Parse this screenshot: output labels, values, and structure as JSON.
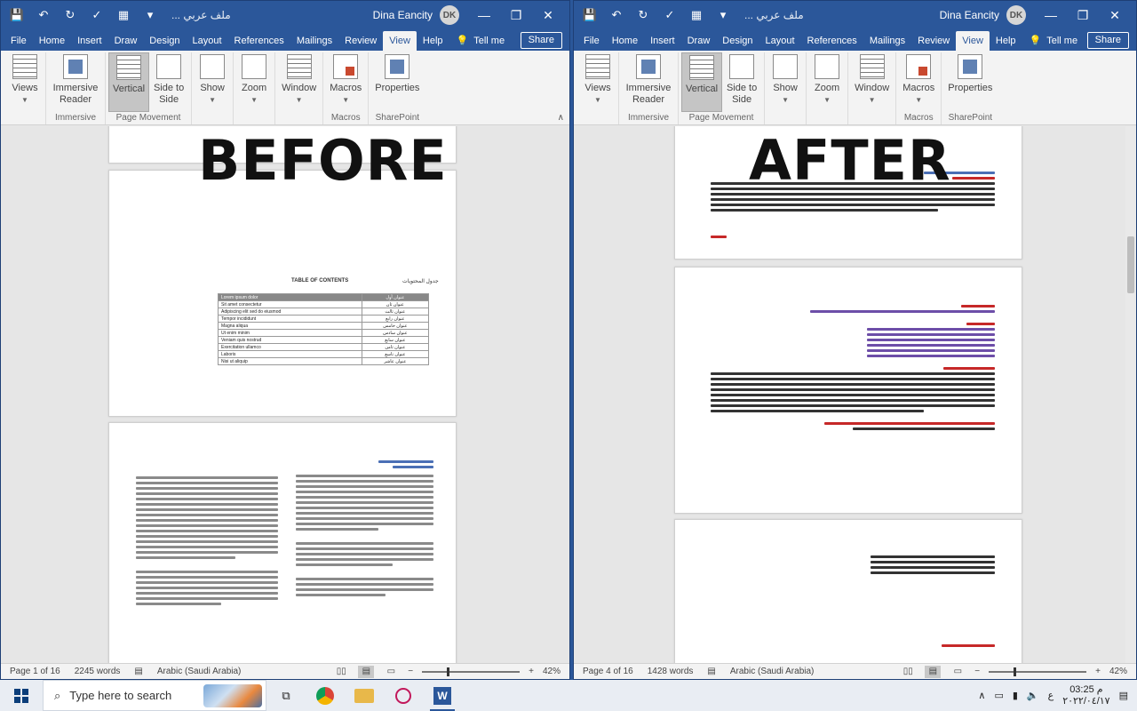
{
  "window": {
    "user_name": "Dina Eancity",
    "user_initials": "DK",
    "doc_title_left": "... ملف عربي",
    "doc_title_right": "... ملف عربي",
    "controls": {
      "minimize": "—",
      "restore": "❐",
      "close": "✕"
    }
  },
  "tabs_left": [
    "File",
    "Home",
    "Insert",
    "Draw",
    "Design",
    "Layout",
    "References",
    "Mailings",
    "Review",
    "View",
    "Help"
  ],
  "tabs_right": [
    "File",
    "Home",
    "Insert",
    "Draw",
    "Design",
    "Layout",
    "References",
    "Mailings",
    "Review",
    "View",
    "Help"
  ],
  "active_tab": "View",
  "tell_me": "Tell me",
  "share": "Share",
  "ribbon": {
    "views": "Views",
    "immersive_reader": "Immersive Reader",
    "immersive_group": "Immersive",
    "vertical": "Vertical",
    "side_to_side": "Side to Side",
    "page_movement_group": "Page Movement",
    "show": "Show",
    "zoom": "Zoom",
    "window": "Window",
    "macros": "Macros",
    "macros_group": "Macros",
    "properties": "Properties",
    "sharepoint_group": "SharePoint"
  },
  "overlay": {
    "before": "BEFORE",
    "after": "AFTER"
  },
  "toc": {
    "title": "TABLE OF CONTENTS",
    "title_ar": "جدول المحتويات",
    "rows": [
      [
        "Lorem ipsum dolor",
        "عنوان أول"
      ],
      [
        "Sit amet consectetur",
        "عنوان ثان"
      ],
      [
        "Adipiscing elit sed do eiusmod",
        "عنوان ثالث"
      ],
      [
        "Tempor incididunt",
        "عنوان رابع"
      ],
      [
        "Magna aliqua",
        "عنوان خامس"
      ],
      [
        "Ut enim minim",
        "عنوان سادس"
      ],
      [
        "Veniam quis nostrud",
        "عنوان سابع"
      ],
      [
        "Exercitation ullamco",
        "عنوان ثامن"
      ],
      [
        "Laboris",
        "عنوان تاسع"
      ],
      [
        "Nisi ut aliquip",
        "عنوان عاشر"
      ]
    ]
  },
  "status_left": {
    "page": "Page 1 of 16",
    "words": "2245 words",
    "language": "Arabic (Saudi Arabia)",
    "zoom": "42%"
  },
  "status_right": {
    "page": "Page 4 of 16",
    "words": "1428 words",
    "language": "Arabic (Saudi Arabia)",
    "zoom": "42%"
  },
  "taskbar": {
    "search_placeholder": "Type here to search",
    "time": "03:25 م",
    "date": "٢٠٢٢/٠٤/١٧",
    "lang": "ع"
  }
}
